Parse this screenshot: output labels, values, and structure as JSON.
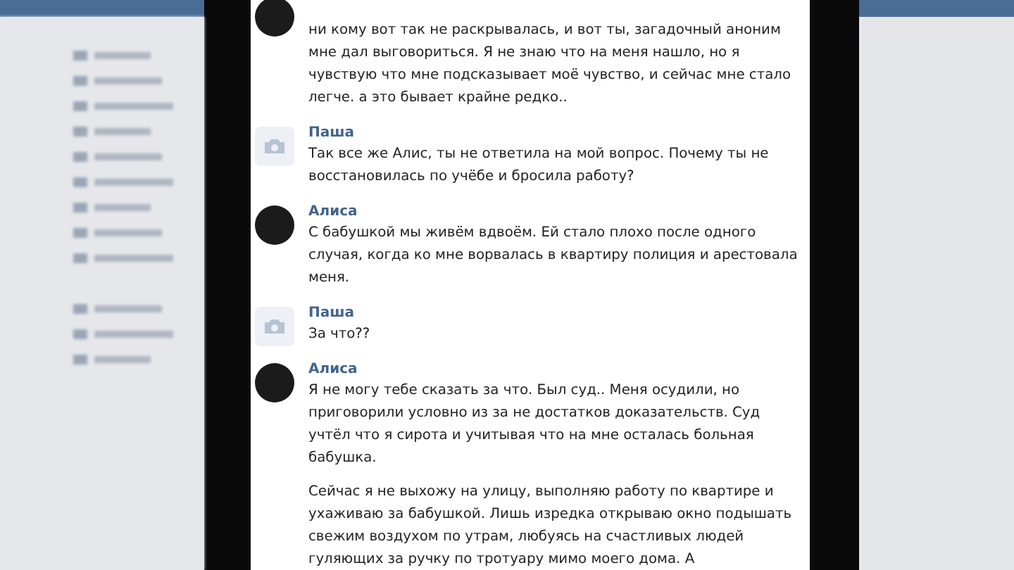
{
  "messages": [
    {
      "kind": "photo",
      "paragraphs": [
        "ни кому вот так не раскрывалась, и вот ты, загадочный аноним мне дал выговориться. Я не знаю что на меня нашло, но я чувствую что мне подсказывает моё чувство, и сейчас мне стало легче. а это бывает крайне редко.."
      ]
    },
    {
      "author": "Паша",
      "kind": "camera",
      "paragraphs": [
        "Так все же Алис, ты не ответила на мой вопрос. Почему ты не восстановилась по учёбе и бросила работу?"
      ]
    },
    {
      "author": "Алиса",
      "kind": "photo",
      "paragraphs": [
        "С бабушкой мы живём вдвоём. Ей стало плохо после одного случая, когда ко мне ворвалась в квартиру полиция и арестовала меня."
      ]
    },
    {
      "author": "Паша",
      "kind": "camera",
      "paragraphs": [
        "За что??"
      ]
    },
    {
      "author": "Алиса",
      "kind": "photo",
      "paragraphs": [
        "Я не могу тебе сказать за что. Был суд.. Меня осудили, но приговорили условно из за не достатков доказательств. Суд учтёл что я сирота и учитывая что на мне осталась больная бабушка.",
        "Сейчас я не выхожу на улицу, выполняю работу по квартире и ухаживаю за бабушкой. Лишь изредка открываю окно подышать свежим воздухом по утрам, любуясь на счастливых людей гуляющих за ручку по тротуару мимо моего дома. А"
      ]
    }
  ]
}
